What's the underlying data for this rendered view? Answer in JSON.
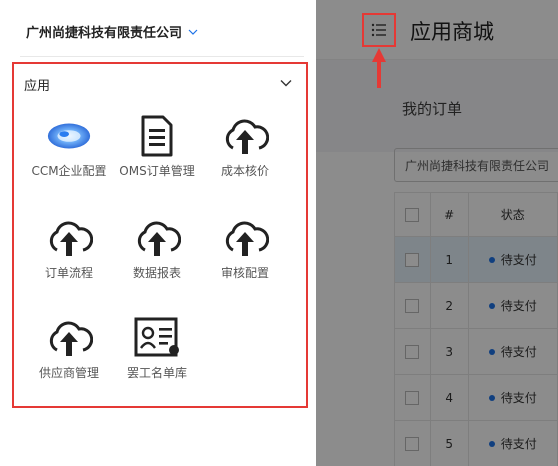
{
  "drawer": {
    "company": "广州尚捷科技有限责任公司",
    "section_title": "应用",
    "apps": [
      {
        "label": "CCM企业配置",
        "icon": "ccm-logo-icon"
      },
      {
        "label": "OMS订单管理",
        "icon": "document-icon"
      },
      {
        "label": "成本核价",
        "icon": "cloud-upload-icon"
      },
      {
        "label": "订单流程",
        "icon": "cloud-upload-icon"
      },
      {
        "label": "数据报表",
        "icon": "cloud-upload-icon"
      },
      {
        "label": "审核配置",
        "icon": "cloud-upload-icon"
      },
      {
        "label": "供应商管理",
        "icon": "cloud-upload-icon"
      },
      {
        "label": "罢工名单库",
        "icon": "id-card-icon"
      }
    ]
  },
  "main": {
    "title": "应用商城",
    "orders_title": "我的订单",
    "company_filter": "广州尚捷科技有限责任公司",
    "table": {
      "headers": [
        "#",
        "状态"
      ],
      "rows": [
        {
          "num": "1",
          "status": "待支付",
          "selected": true
        },
        {
          "num": "2",
          "status": "待支付",
          "selected": false
        },
        {
          "num": "3",
          "status": "待支付",
          "selected": false
        },
        {
          "num": "4",
          "status": "待支付",
          "selected": false
        },
        {
          "num": "5",
          "status": "待支付",
          "selected": false
        }
      ]
    }
  },
  "colors": {
    "highlight": "#e53935",
    "status_dot": "#1e73e8",
    "selected_row": "#e6f3fb"
  }
}
